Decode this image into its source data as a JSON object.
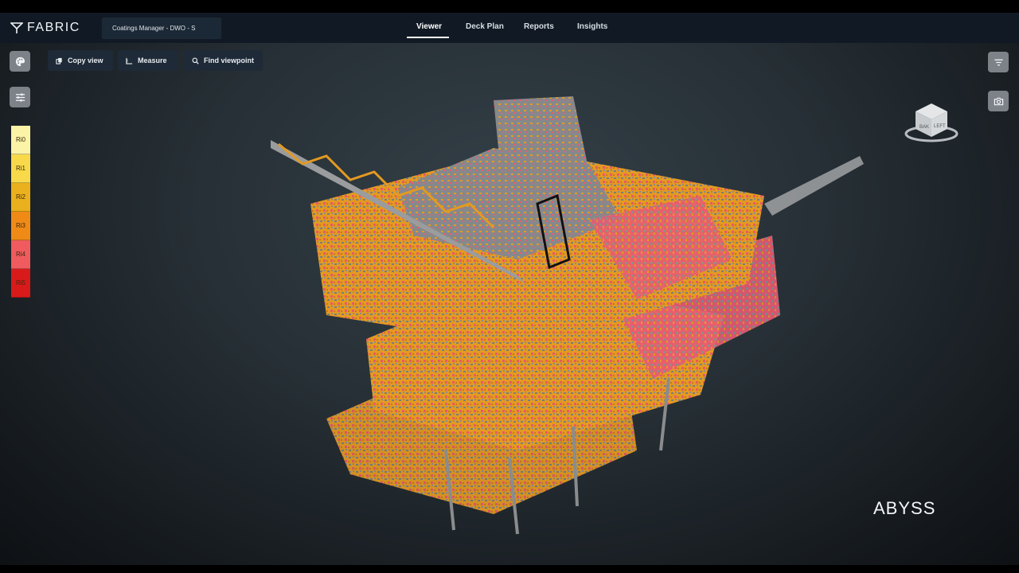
{
  "app": {
    "name": "FABRIC",
    "context": "Coatings Manager - DWO - S"
  },
  "nav": {
    "tabs": [
      {
        "label": "Viewer",
        "active": true
      },
      {
        "label": "Deck Plan",
        "active": false
      },
      {
        "label": "Reports",
        "active": false
      },
      {
        "label": "Insights",
        "active": false
      }
    ]
  },
  "toolbar": {
    "copy_view": "Copy view",
    "measure": "Measure",
    "find_viewpoint": "Find viewpoint"
  },
  "legend": {
    "items": [
      {
        "label": "Ri0",
        "color": "#fbf3a6"
      },
      {
        "label": "Ri1",
        "color": "#f7d94a"
      },
      {
        "label": "Ri2",
        "color": "#eab01d"
      },
      {
        "label": "Ri3",
        "color": "#f08a17"
      },
      {
        "label": "Ri4",
        "color": "#ef5b5e"
      },
      {
        "label": "Ri5",
        "color": "#d81a1a"
      }
    ]
  },
  "viewcube": {
    "faces": [
      "BAK",
      "LEFT"
    ]
  },
  "brand": "ABYSS",
  "colors": {
    "topbar": "#111a24",
    "button_bg": "#1e2a37",
    "side_button_bg": "#7c8288"
  }
}
